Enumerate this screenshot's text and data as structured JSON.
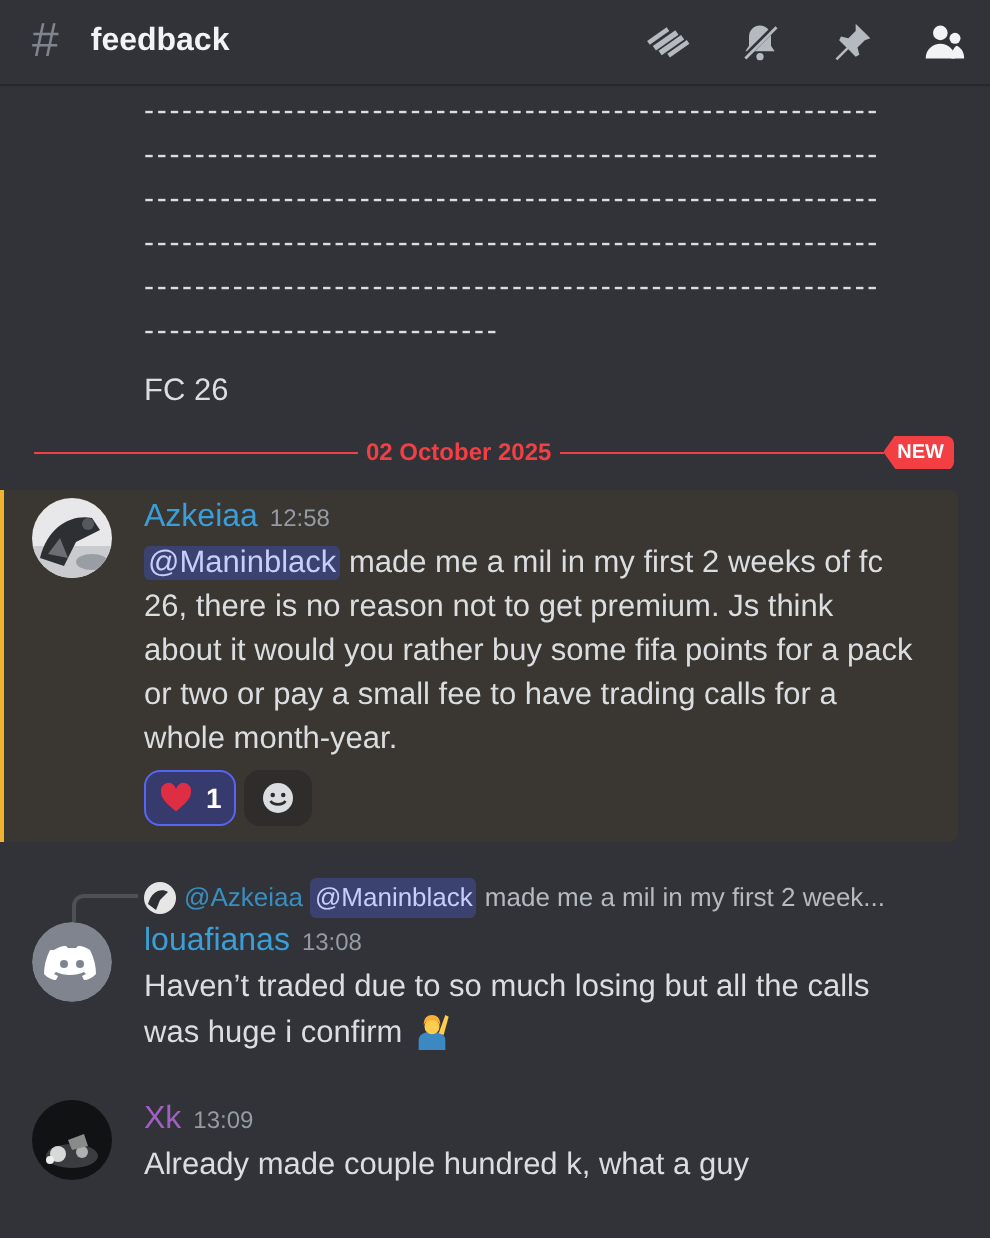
{
  "header": {
    "channel_icon": "#",
    "title": "feedback"
  },
  "continuation": {
    "lines": [
      "----------------------------------------------------------",
      "----------------------------------------------------------",
      "----------------------------------------------------------",
      "----------------------------------------------------------",
      "----------------------------------------------------------",
      "----------------------------"
    ],
    "text": "FC 26"
  },
  "divider": {
    "date": "02 October 2025",
    "badge": "NEW"
  },
  "messages": [
    {
      "author": "Azkeiaa",
      "color": "#3a9fd8",
      "time": "12:58",
      "kind": "picture",
      "highlighted": true,
      "mention": "@Maninblack",
      "text": "made me a mil in my first 2 weeks of fc 26, there is no reason not to get premium. Js think about it would you rather buy some fifa points for a pack or two or pay a small fee to have trading calls for a whole month-year.",
      "reactions": [
        {
          "count": "1",
          "selected": true
        }
      ]
    },
    {
      "author": "louafianas",
      "color": "#3a9fd8",
      "time": "13:08",
      "kind": "default_avatar",
      "highlighted": false,
      "reply": {
        "author": "@Azkeiaa",
        "mention": "@Maninblack",
        "text": "made me a mil in my first 2 week..."
      },
      "text": "Haven’t traded due to so much losing but all the calls was huge i confirm",
      "trailing_emoji": true
    },
    {
      "author": "Xk",
      "color": "#a15fc4",
      "time": "13:09",
      "kind": "picture",
      "highlighted": false,
      "text": "Already made couple hundred k, what a guy"
    }
  ]
}
